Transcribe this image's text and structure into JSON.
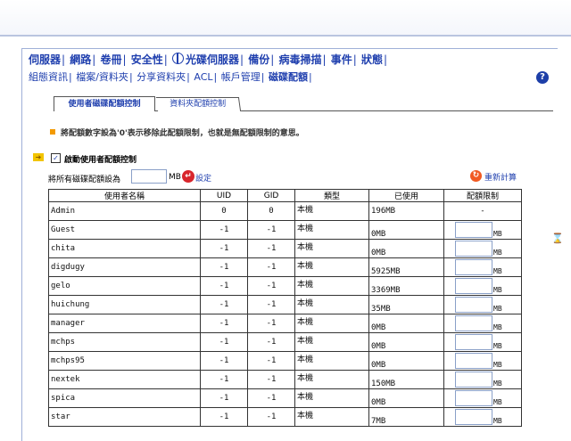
{
  "menu1": [
    "伺服器",
    "網路",
    "卷冊",
    "安全性",
    "光碟伺服器",
    "備份",
    "病毒掃描",
    "事件",
    "狀態"
  ],
  "menu2": [
    "組態資訊",
    "檔案/資料夾",
    "分享資料夾",
    "ACL",
    "帳戶管理",
    "磁碟配額"
  ],
  "help": "?",
  "tabs": [
    "使用者磁碟配額控制",
    "資料夾配額控制"
  ],
  "tip": "將配額數字設為'0'表示移除此配額限制，也就是無配額限制的意思。",
  "enable": {
    "checked": "✓",
    "label": "啟動使用者配額控制"
  },
  "set_all": {
    "label": "將所有磁碟配額設為",
    "unit": "MB",
    "button": "設定"
  },
  "recalc": "重新計算",
  "table": {
    "headers": [
      "使用者名稱",
      "UID",
      "GID",
      "類型",
      "已使用",
      "配額限制"
    ],
    "rows": [
      {
        "name": "Admin",
        "uid": "0",
        "gid": "0",
        "type": "本機",
        "used": "196MB",
        "limit": "-"
      },
      {
        "name": "Guest",
        "uid": "-1",
        "gid": "-1",
        "type": "本機",
        "used": "0MB",
        "limit": "MB"
      },
      {
        "name": "chita",
        "uid": "-1",
        "gid": "-1",
        "type": "本機",
        "used": "0MB",
        "limit": "MB"
      },
      {
        "name": "digdugy",
        "uid": "-1",
        "gid": "-1",
        "type": "本機",
        "used": "5925MB",
        "limit": "MB"
      },
      {
        "name": "gelo",
        "uid": "-1",
        "gid": "-1",
        "type": "本機",
        "used": "3369MB",
        "limit": "MB"
      },
      {
        "name": "huichung",
        "uid": "-1",
        "gid": "-1",
        "type": "本機",
        "used": "35MB",
        "limit": "MB"
      },
      {
        "name": "manager",
        "uid": "-1",
        "gid": "-1",
        "type": "本機",
        "used": "0MB",
        "limit": "MB"
      },
      {
        "name": "mchps",
        "uid": "-1",
        "gid": "-1",
        "type": "本機",
        "used": "0MB",
        "limit": "MB"
      },
      {
        "name": "mchps95",
        "uid": "-1",
        "gid": "-1",
        "type": "本機",
        "used": "0MB",
        "limit": "MB"
      },
      {
        "name": "nextek",
        "uid": "-1",
        "gid": "-1",
        "type": "本機",
        "used": "150MB",
        "limit": "MB"
      },
      {
        "name": "spica",
        "uid": "-1",
        "gid": "-1",
        "type": "本機",
        "used": "0MB",
        "limit": "MB"
      },
      {
        "name": "star",
        "uid": "-1",
        "gid": "-1",
        "type": "本機",
        "used": "7MB",
        "limit": "MB"
      }
    ]
  },
  "hourglass": "⌛"
}
